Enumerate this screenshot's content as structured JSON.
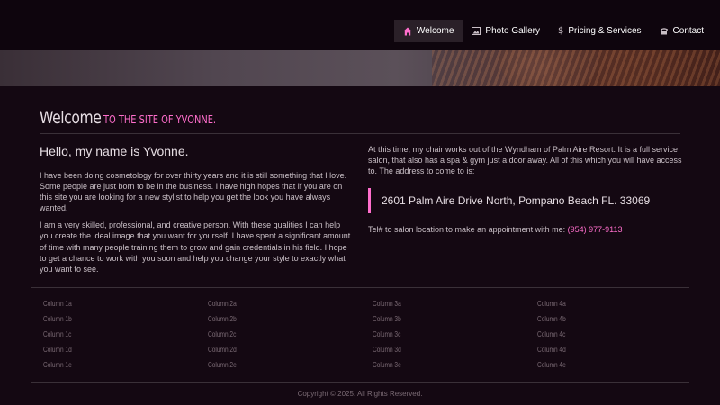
{
  "nav": {
    "items": [
      {
        "label": "Welcome",
        "icon": "home-icon",
        "active": true
      },
      {
        "label": "Photo Gallery",
        "icon": "image-icon",
        "active": false
      },
      {
        "label": "Pricing & Services",
        "icon": "dollar-icon",
        "active": false
      },
      {
        "label": "Contact",
        "icon": "phone-icon",
        "active": false
      }
    ]
  },
  "heading": {
    "main": "Welcome",
    "sub": "to the site of Yvonne."
  },
  "left": {
    "hello": "Hello, my name is Yvonne.",
    "p1": "I have been doing cosmetology for over thirty years and it is still something that I love. Some people are just born to be in the business. I have high hopes that if you are on this site you are looking for a new stylist to help you get the look you have always wanted.",
    "p2": "I am a very skilled, professional, and creative person. With these qualities I can help you create the ideal image that you want for yourself. I have spent a significant amount of time with many people training them to grow and gain credentials in his field. I hope to get a chance to work with you soon and help you change your style to exactly what you want to see."
  },
  "right": {
    "p1": "At this time, my chair works out of the Wyndham of Palm Aire Resort. It is a full service salon, that also has a spa & gym just a door away. All of this which you will have access to. The address to come to is:",
    "address": "2601 Palm Aire Drive North, Pompano Beach FL. 33069",
    "tel_text": "Tel# to salon location to make an appointment with me: ",
    "tel_number": "(954) 977-9113"
  },
  "footer": {
    "columns": [
      [
        "Column 1a",
        "Column 1b",
        "Column 1c",
        "Column 1d",
        "Column 1e"
      ],
      [
        "Column 2a",
        "Column 2b",
        "Column 2c",
        "Column 2d",
        "Column 2e"
      ],
      [
        "Column 3a",
        "Column 3b",
        "Column 3c",
        "Column 3d",
        "Column 3e"
      ],
      [
        "Column 4a",
        "Column 4b",
        "Column 4c",
        "Column 4d",
        "Column 4e"
      ]
    ],
    "copyright": "Copyright © 2025. All Rights Reserved."
  },
  "colors": {
    "accent": "#ff6ecc",
    "background": "#140812",
    "nav_bg": "#0e050d"
  }
}
